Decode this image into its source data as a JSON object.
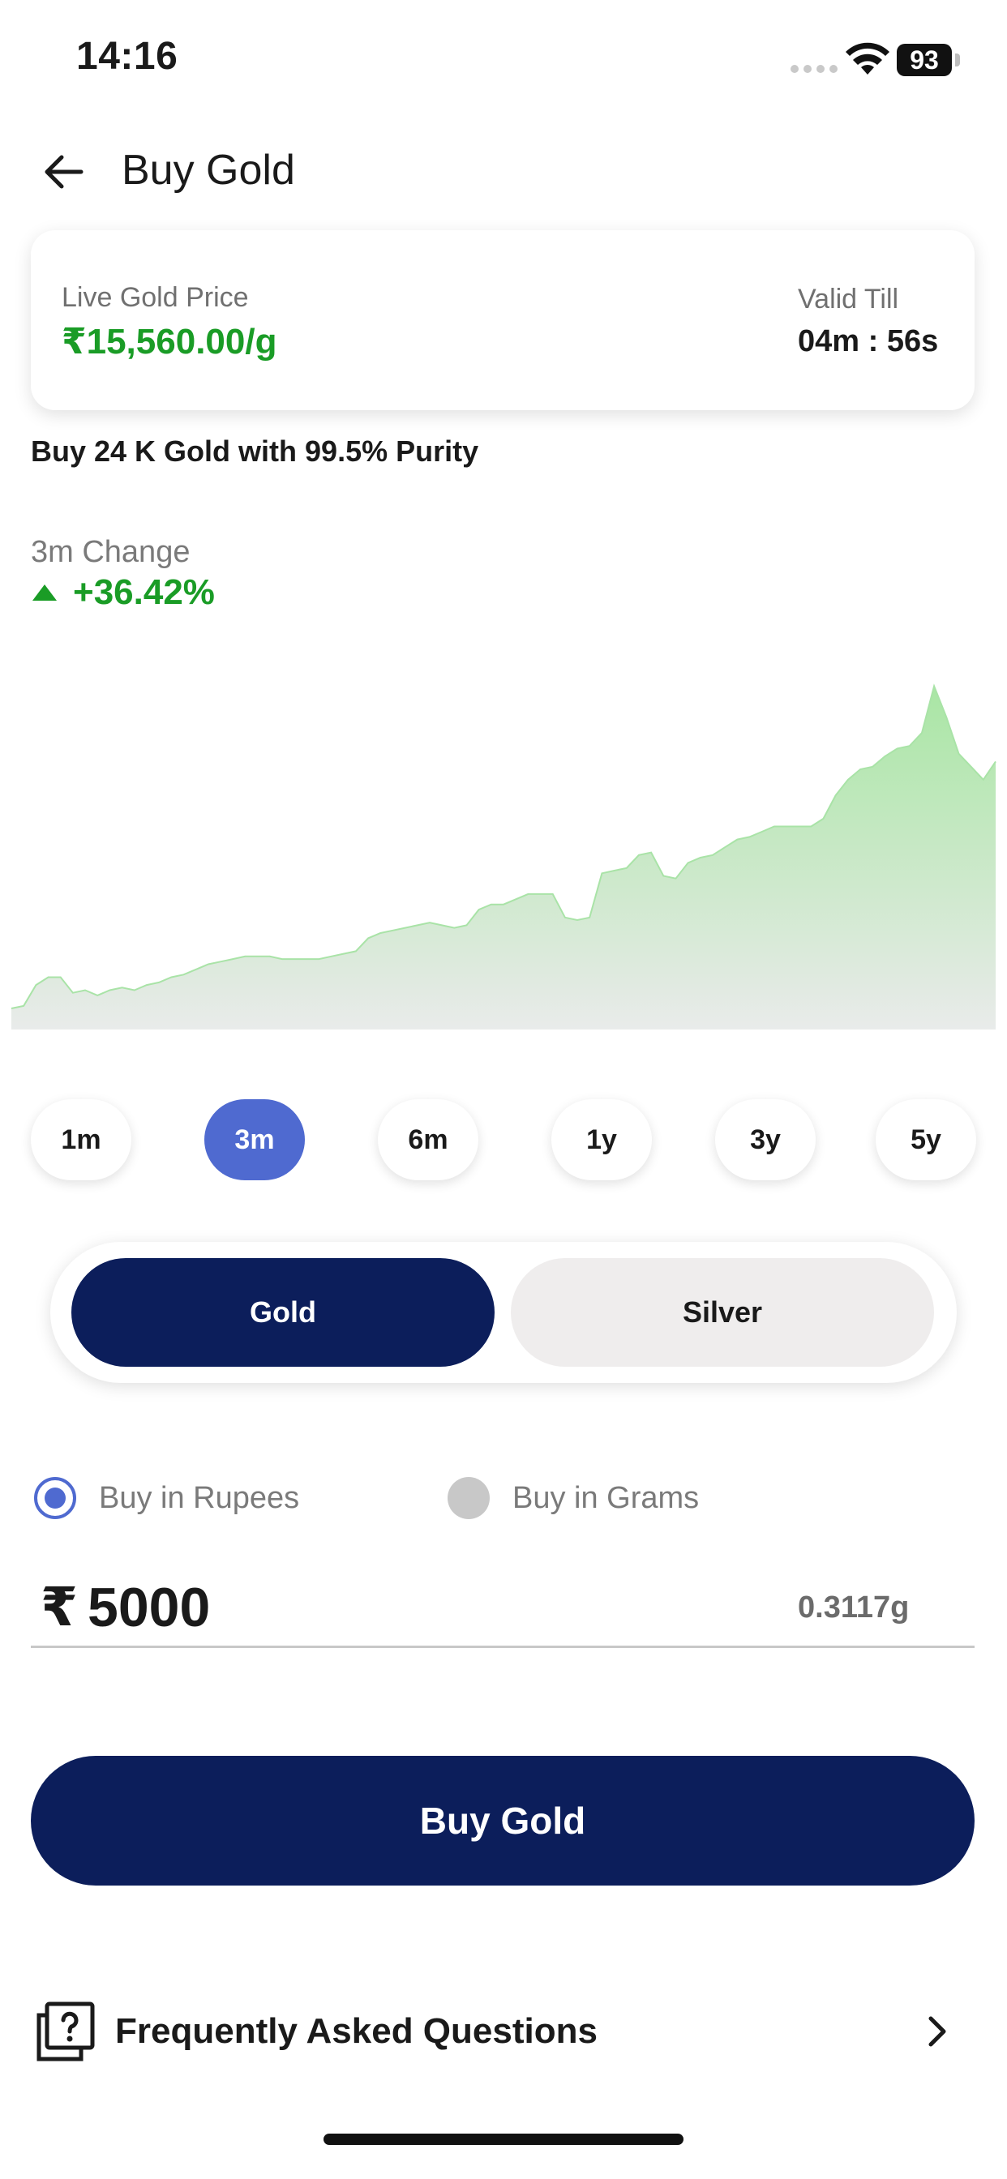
{
  "status_bar": {
    "time": "14:16",
    "battery": "93"
  },
  "header": {
    "title": "Buy Gold",
    "back_icon": "arrow-left-icon"
  },
  "price_card": {
    "live_label": "Live Gold Price",
    "live_price": "₹15,560.00/g",
    "valid_label": "Valid Till",
    "valid_time": "04m : 56s"
  },
  "purity_text": "Buy 24 K Gold with 99.5% Purity",
  "change": {
    "label": "3m Change",
    "value": "+36.42%",
    "direction_icon": "triangle-up-icon",
    "color": "#1a9c26"
  },
  "chart_data": {
    "type": "area",
    "title": "",
    "xlabel": "",
    "ylabel": "",
    "axes_visible": false,
    "grid": false,
    "fill_color": "#b6e6b2",
    "line_color": "#a9e3a7",
    "y": [
      11000,
      11010,
      11090,
      11120,
      11120,
      11060,
      11070,
      11050,
      11070,
      11080,
      11070,
      11090,
      11100,
      11120,
      11130,
      11150,
      11170,
      11180,
      11190,
      11200,
      11200,
      11200,
      11190,
      11190,
      11190,
      11190,
      11200,
      11210,
      11220,
      11270,
      11290,
      11300,
      11310,
      11320,
      11330,
      11320,
      11310,
      11320,
      11380,
      11400,
      11400,
      11420,
      11440,
      11440,
      11440,
      11350,
      11340,
      11350,
      11520,
      11530,
      11540,
      11590,
      11600,
      11510,
      11500,
      11560,
      11580,
      11590,
      11620,
      11650,
      11660,
      11680,
      11700,
      11700,
      11700,
      11700,
      11730,
      11820,
      11880,
      11920,
      11930,
      11970,
      12000,
      12010,
      12060,
      12240,
      12120,
      11980,
      11930,
      11880,
      11950
    ]
  },
  "ranges": [
    {
      "label": "1m",
      "active": false
    },
    {
      "label": "3m",
      "active": true
    },
    {
      "label": "6m",
      "active": false
    },
    {
      "label": "1y",
      "active": false
    },
    {
      "label": "3y",
      "active": false
    },
    {
      "label": "5y",
      "active": false
    }
  ],
  "metal_toggle": {
    "gold": "Gold",
    "silver": "Silver",
    "selected": "Gold"
  },
  "buy_mode": {
    "rupees": "Buy in Rupees",
    "grams": "Buy in Grams",
    "selected": "rupees"
  },
  "amount": {
    "currency": "₹",
    "value": "5000",
    "grams": "0.3117g"
  },
  "buy_button": "Buy Gold",
  "faq": {
    "label": "Frequently Asked Questions",
    "icon": "faq-question-icon",
    "chevron": "chevron-right-icon"
  },
  "colors": {
    "primary_navy": "#0c1e5b",
    "accent_blue": "#4f6ad0",
    "price_green": "#1a9c26"
  }
}
